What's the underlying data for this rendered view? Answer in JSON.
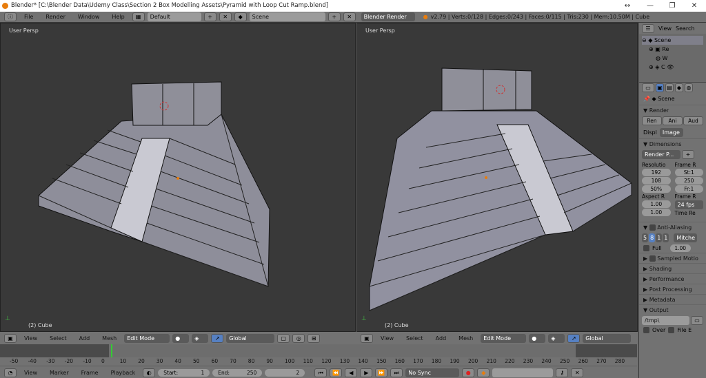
{
  "window": {
    "title": "Blender* [C:\\Blender Data\\Udemy Class\\Section 2 Box Modelling Assets\\Pyramid with Loop Cut Ramp.blend]",
    "controls": [
      "↔",
      "—",
      "❐",
      "✕"
    ]
  },
  "topbar": {
    "menus": [
      "File",
      "Render",
      "Window",
      "Help"
    ],
    "layout": "Default",
    "scene": "Scene",
    "engine": "Blender Render",
    "stats": "v2.79 | Verts:0/128 | Edges:0/243 | Faces:0/115 | Tris:230 | Mem:10.50M | Cube"
  },
  "viewports": [
    {
      "label": "User Persp",
      "object": "(2) Cube"
    },
    {
      "label": "User Persp",
      "object": "(2) Cube"
    }
  ],
  "view3d_header": {
    "menus": [
      "View",
      "Select",
      "Add",
      "Mesh"
    ],
    "mode": "Edit Mode",
    "orientation": "Global"
  },
  "timeline": {
    "ticks": [
      "-50",
      "-40",
      "-30",
      "-20",
      "-10",
      "0",
      "10",
      "20",
      "30",
      "40",
      "50",
      "60",
      "70",
      "80",
      "90",
      "100",
      "110",
      "120",
      "130",
      "140",
      "150",
      "160",
      "170",
      "180",
      "190",
      "200",
      "210",
      "220",
      "230",
      "240",
      "250",
      "260",
      "270",
      "280"
    ],
    "current_frame_value": 2
  },
  "bottombar": {
    "menus": [
      "View",
      "Marker",
      "Frame",
      "Playback"
    ],
    "start_label": "Start:",
    "start": "1",
    "end_label": "End:",
    "end": "250",
    "current": "2",
    "sync": "No Sync"
  },
  "outliner": {
    "menus": [
      "View",
      "Search"
    ],
    "items": [
      "Scene",
      "Re",
      "W",
      "C"
    ]
  },
  "properties": {
    "context": "Scene",
    "render_title": "Render",
    "render_buttons": [
      "Ren",
      "Ani",
      "Aud"
    ],
    "display_label": "Displ",
    "display_value": "Image",
    "dimensions_title": "Dimensions",
    "preset": "Render P...",
    "resolution_label": "Resolutio",
    "res_x": "192",
    "res_y": "108",
    "res_pct": "50%",
    "frame_range_label": "Frame R",
    "start": "St:1",
    "end": "250",
    "step": "Fr:1",
    "aspect_label": "Aspect R",
    "aspect_x": "1.00",
    "aspect_y": "1.00",
    "frame_rate_label": "Frame R",
    "fps": "24 fps",
    "time_remap_label": "Time Re",
    "aa_title": "Anti-Aliasing",
    "aa_samples": [
      "5",
      "8",
      "1",
      "1"
    ],
    "aa_filter": "Mitche",
    "full_label": "Full",
    "filter_size": "1.00",
    "collapsed": [
      "Sampled Motio",
      "Shading",
      "Performance",
      "Post Processing",
      "Metadata"
    ],
    "output_title": "Output",
    "output_path": "/tmp\\",
    "overwrite": "Over",
    "file_ext": "File E"
  }
}
